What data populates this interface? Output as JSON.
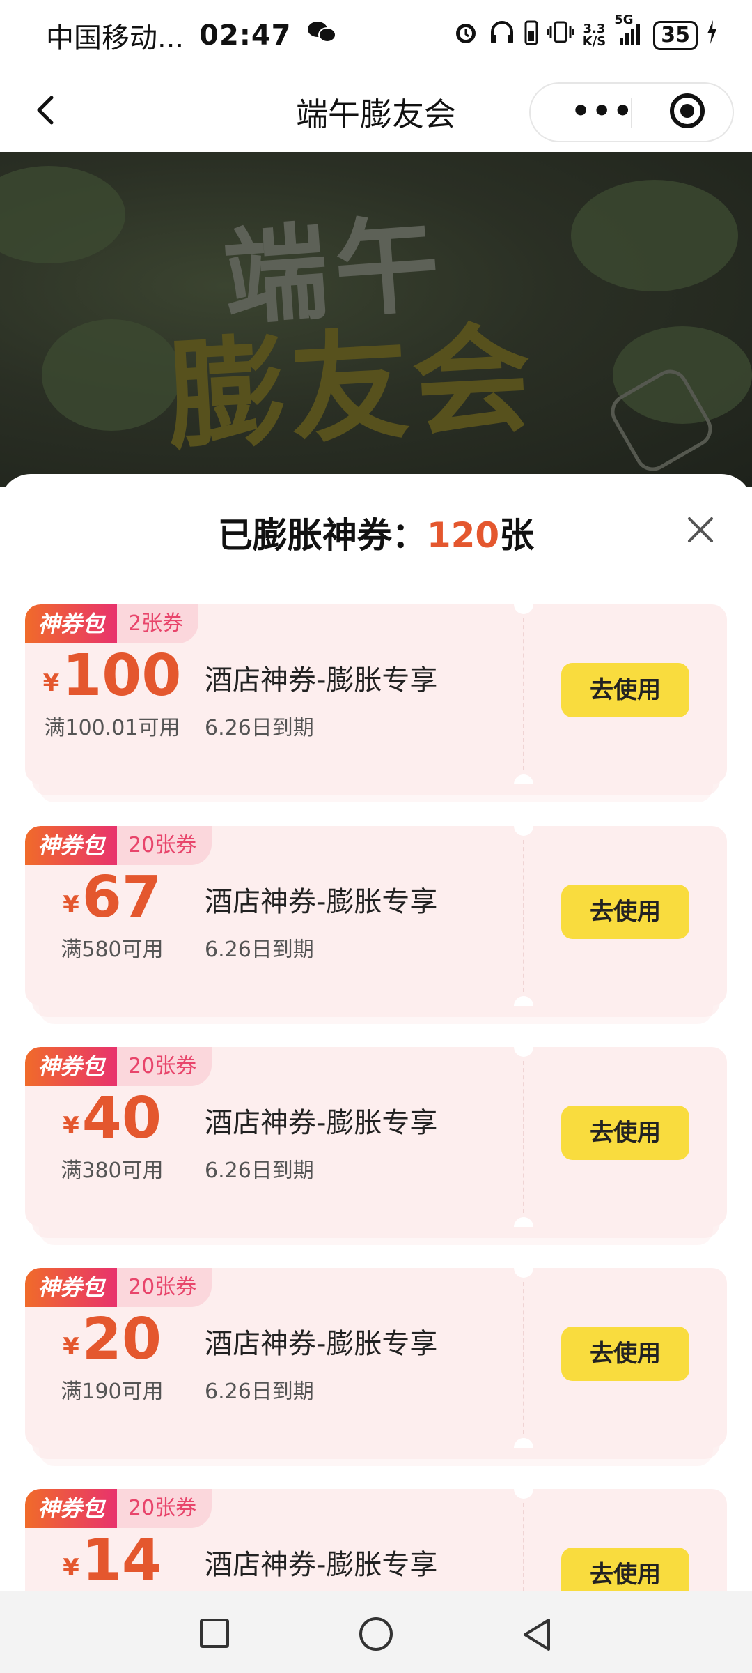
{
  "status_bar": {
    "carrier": "中国移动...",
    "time": "02:47",
    "net_speed_top": "3.3",
    "net_speed_bottom": "K/S",
    "signal_label": "5G",
    "battery": "35"
  },
  "nav": {
    "title": "端午膨友会"
  },
  "banner": {
    "line1": "端午",
    "line2": "膨友会"
  },
  "sheet": {
    "title_prefix": "已膨胀神券：",
    "count": "120",
    "title_suffix": "张"
  },
  "coupons": [
    {
      "tag": "神券包",
      "qty": "2张券",
      "currency": "¥",
      "amount": "100",
      "condition": "满100.01可用",
      "title": "酒店神券-膨胀专享",
      "expiry": "6.26日到期",
      "button": "去使用"
    },
    {
      "tag": "神券包",
      "qty": "20张券",
      "currency": "¥",
      "amount": "67",
      "condition": "满580可用",
      "title": "酒店神券-膨胀专享",
      "expiry": "6.26日到期",
      "button": "去使用"
    },
    {
      "tag": "神券包",
      "qty": "20张券",
      "currency": "¥",
      "amount": "40",
      "condition": "满380可用",
      "title": "酒店神券-膨胀专享",
      "expiry": "6.26日到期",
      "button": "去使用"
    },
    {
      "tag": "神券包",
      "qty": "20张券",
      "currency": "¥",
      "amount": "20",
      "condition": "满190可用",
      "title": "酒店神券-膨胀专享",
      "expiry": "6.26日到期",
      "button": "去使用"
    },
    {
      "tag": "神券包",
      "qty": "20张券",
      "currency": "¥",
      "amount": "14",
      "condition": "",
      "title": "酒店神券-膨胀专享",
      "expiry": "",
      "button": "去使用"
    }
  ],
  "colors": {
    "accent": "#e4572e",
    "button": "#f9dc3e",
    "card_bg": "#fdeeee"
  }
}
